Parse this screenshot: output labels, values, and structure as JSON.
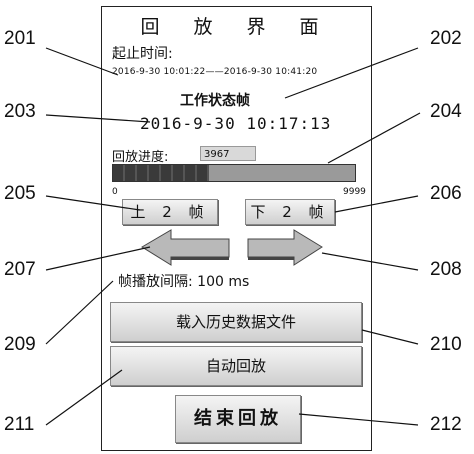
{
  "panel": {
    "title": "回 放 界 面",
    "time_label": "起止时间:",
    "time_range": "2016-9-30  10:01:22——2016-9-30  10:41:20",
    "status_text": "工作状态帧",
    "current_time": "2016-9-30  10:17:13",
    "progress_label": "回放进度:",
    "current_frame": "3967",
    "progress_fraction": 0.3967,
    "progress_min": "0",
    "progress_max": "9999",
    "prev_button": "上 2  帧",
    "next_button": "下 2  帧",
    "interval_text": "帧播放间隔: 100  ms",
    "load_button": "载入历史数据文件",
    "auto_button": "自动回放",
    "end_button": "结束回放"
  },
  "callouts": {
    "c201": "201",
    "c202": "202",
    "c203": "203",
    "c204": "204",
    "c205": "205",
    "c206": "206",
    "c207": "207",
    "c208": "208",
    "c209": "209",
    "c210": "210",
    "c211": "211",
    "c212": "212"
  }
}
